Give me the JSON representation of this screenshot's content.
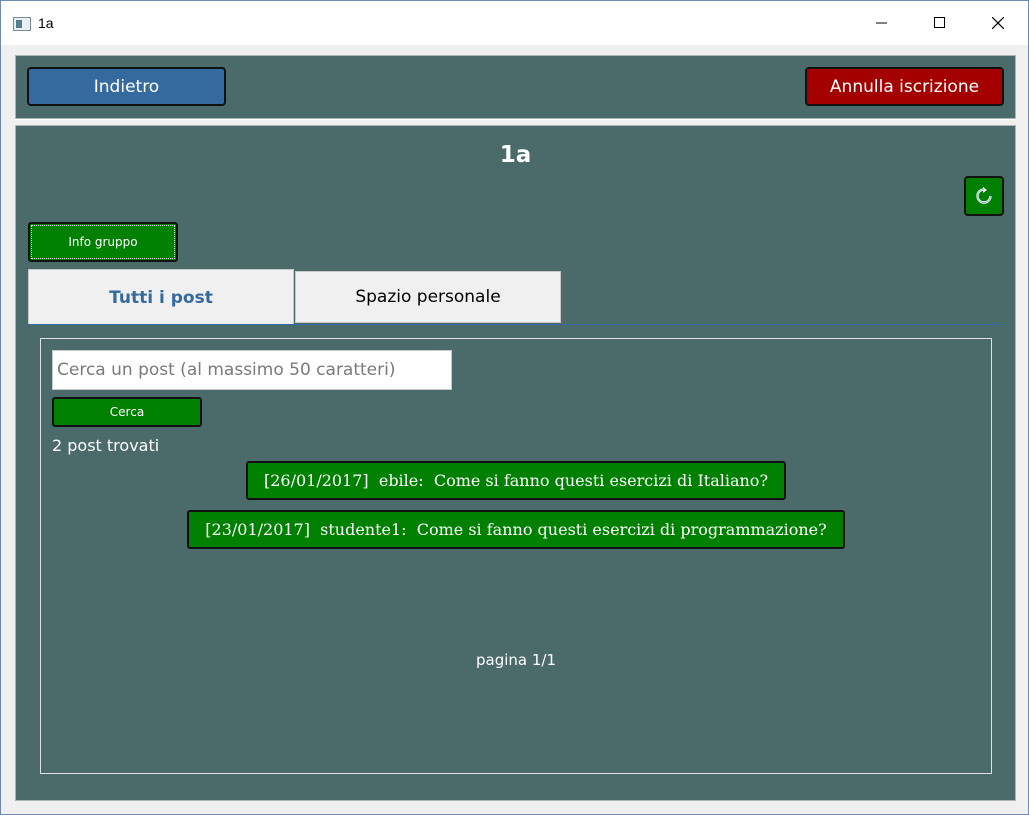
{
  "window": {
    "title": "1a"
  },
  "topbar": {
    "back_label": "Indietro",
    "unsubscribe_label": "Annulla iscrizione"
  },
  "group": {
    "title": "1a",
    "info_label": "Info gruppo",
    "refresh_icon": "refresh-icon"
  },
  "tabs": [
    {
      "label": "Tutti i post",
      "active": true
    },
    {
      "label": "Spazio personale",
      "active": false
    }
  ],
  "search": {
    "placeholder": "Cerca un post (al massimo 50 caratteri)",
    "value": "",
    "button_label": "Cerca"
  },
  "results": {
    "count_text": "2 post trovati",
    "posts": [
      "[26/01/2017]  ebile:  Come si fanno questi esercizi di Italiano?",
      "[23/01/2017]  studente1:  Come si fanno questi esercizi di programmazione?"
    ],
    "pagination": "pagina 1/1"
  },
  "colors": {
    "panel": "#4b6b6a",
    "back_button": "#356a9e",
    "unsubscribe_button": "#a40000",
    "green_button": "#008000"
  }
}
